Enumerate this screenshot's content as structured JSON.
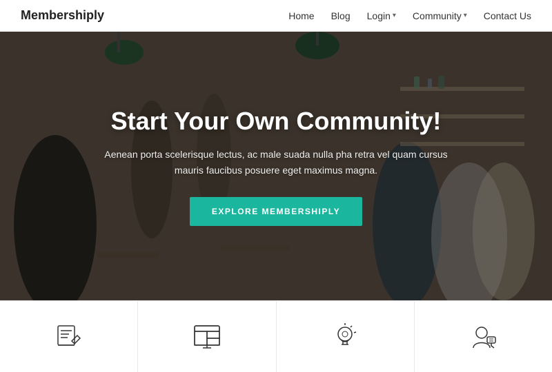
{
  "header": {
    "logo": "Membershiply",
    "nav": [
      {
        "label": "Home",
        "dropdown": false,
        "id": "home"
      },
      {
        "label": "Blog",
        "dropdown": false,
        "id": "blog"
      },
      {
        "label": "Login",
        "dropdown": true,
        "id": "login"
      },
      {
        "label": "Community",
        "dropdown": true,
        "id": "community"
      },
      {
        "label": "Contact Us",
        "dropdown": false,
        "id": "contact"
      }
    ]
  },
  "hero": {
    "title": "Start Your Own Community!",
    "subtitle": "Aenean porta scelerisque lectus, ac male suada nulla pha retra vel quam cursus\nmauris faucibus posuere eget maximus magna.",
    "cta_label": "EXPLORE MEMBERSHIPLY"
  },
  "features": [
    {
      "icon": "edit-design-icon",
      "id": "feature-1"
    },
    {
      "icon": "dashboard-icon",
      "id": "feature-2"
    },
    {
      "icon": "brain-idea-icon",
      "id": "feature-3"
    },
    {
      "icon": "support-icon",
      "id": "feature-4"
    }
  ]
}
